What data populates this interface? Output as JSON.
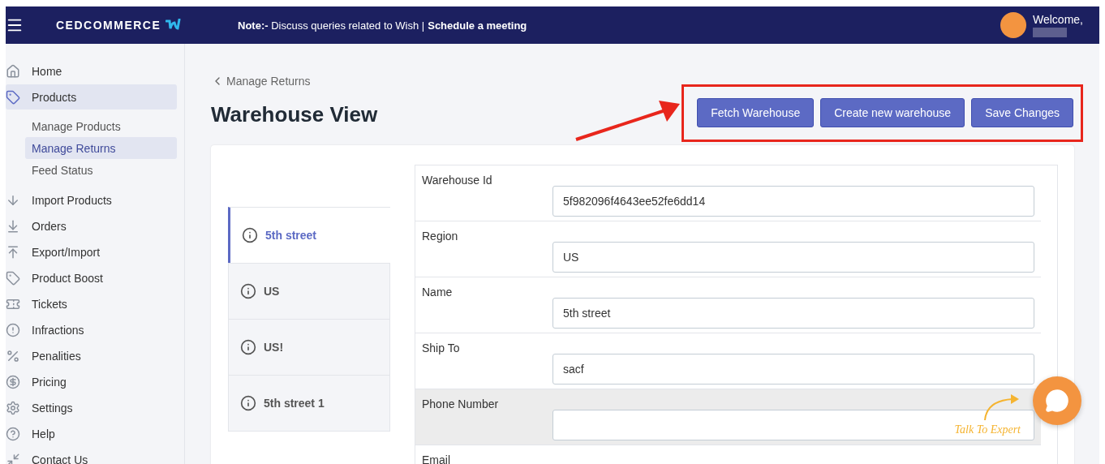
{
  "header": {
    "logo_text": "CEDCOMMERCE",
    "note": "**Note:-** Discuss queries related to Wish |",
    "note_link": "Schedule a meeting",
    "welcome": "Welcome,"
  },
  "sidebar": {
    "items": [
      {
        "label": "Home",
        "selected": false
      },
      {
        "label": "Products",
        "selected": true,
        "children": [
          {
            "label": "Manage Products",
            "selected": false
          },
          {
            "label": "Manage Returns",
            "selected": true
          },
          {
            "label": "Feed Status",
            "selected": false
          }
        ]
      },
      {
        "label": "Import Products",
        "selected": false
      },
      {
        "label": "Orders",
        "selected": false
      },
      {
        "label": "Export/Import",
        "selected": false
      },
      {
        "label": "Product Boost",
        "selected": false
      },
      {
        "label": "Tickets",
        "selected": false
      },
      {
        "label": "Infractions",
        "selected": false
      },
      {
        "label": "Penalities",
        "selected": false
      },
      {
        "label": "Pricing",
        "selected": false
      },
      {
        "label": "Settings",
        "selected": false
      },
      {
        "label": "Help",
        "selected": false
      },
      {
        "label": "Contact Us",
        "selected": false
      }
    ]
  },
  "breadcrumb": "Manage Returns",
  "title": "Warehouse View",
  "buttons": [
    "Fetch Warehouse",
    "Create new warehouse",
    "Save Changes"
  ],
  "warehouses": [
    {
      "label": "5th street",
      "selected": true
    },
    {
      "label": "US",
      "selected": false
    },
    {
      "label": "US!",
      "selected": false
    },
    {
      "label": "5th street 1",
      "selected": false
    }
  ],
  "fields": [
    {
      "label": "Warehouse Id",
      "value": "5f982096f4643ee52fe6dd14",
      "highlighted": false
    },
    {
      "label": "Region",
      "value": "US",
      "highlighted": false
    },
    {
      "label": "Name",
      "value": "5th street",
      "highlighted": false
    },
    {
      "label": "Ship To",
      "value": "sacf",
      "highlighted": false
    },
    {
      "label": "Phone Number",
      "highlighted": true
    },
    {
      "label": "Email",
      "highlighted": false
    }
  ],
  "chat": {
    "caption": "Talk To Expert"
  }
}
